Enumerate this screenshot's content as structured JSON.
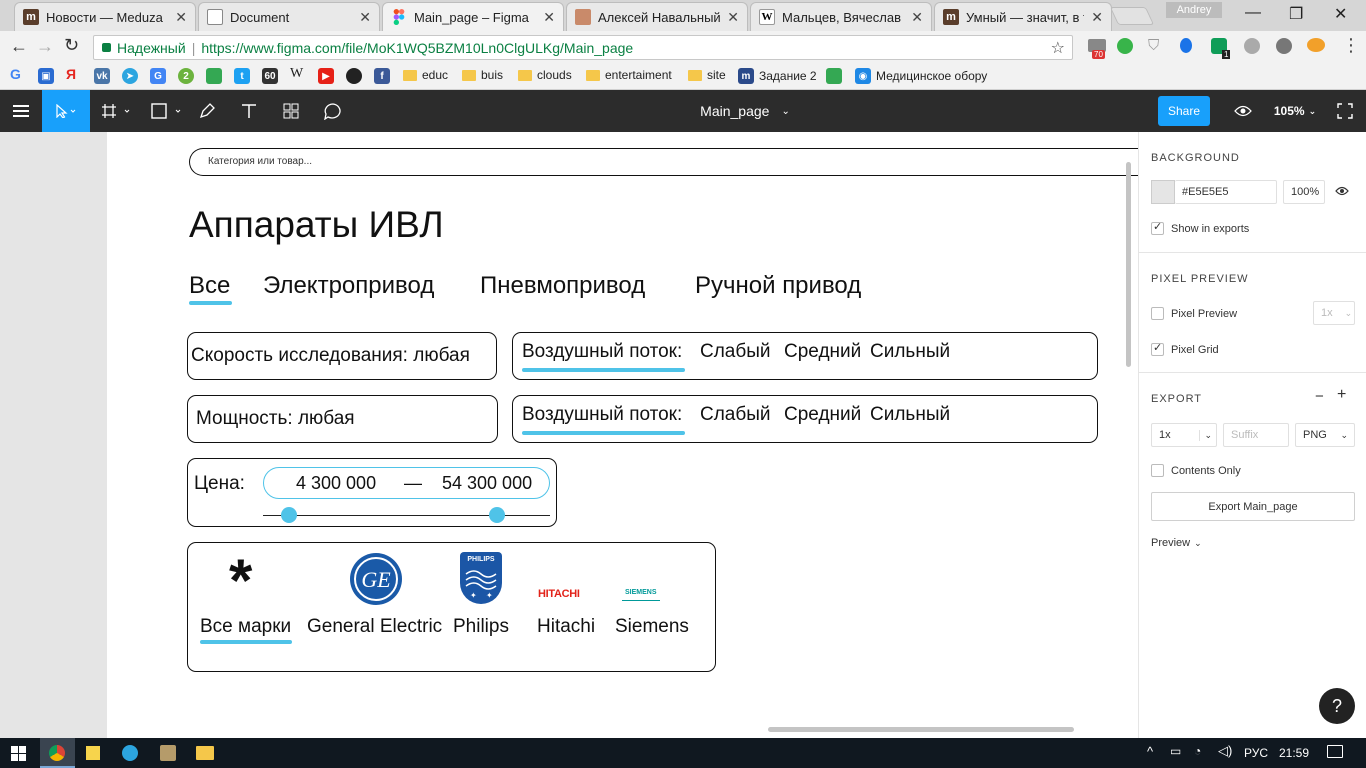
{
  "browser": {
    "tabs": [
      {
        "title": "Новости — Meduza",
        "icon": "meduza-icon"
      },
      {
        "title": "Document",
        "icon": "document-icon"
      },
      {
        "title": "Main_page – Figma",
        "icon": "figma-icon",
        "active": true
      },
      {
        "title": "Алексей Навальный",
        "icon": "avatar-icon"
      },
      {
        "title": "Мальцев, Вячеслав Вя",
        "icon": "wikipedia-icon"
      },
      {
        "title": "Умный — значит, в тк",
        "icon": "meduza-icon"
      }
    ],
    "user_name": "Andrey",
    "secure_label": "Надежный",
    "url": "https://www.figma.com/file/MoK1WQ5BZM10Ln0ClgULKg/Main_page",
    "ext_badges": {
      "mail": "70",
      "green": "1"
    },
    "bookmarks": [
      "educ",
      "buis",
      "clouds",
      "entertaiment",
      "site",
      "Задание 2",
      "Медицинское обору"
    ]
  },
  "figma": {
    "file_name": "Main_page",
    "share_label": "Share",
    "zoom": "105%",
    "panel": {
      "background_title": "BACKGROUND",
      "bg_hex": "#E5E5E5",
      "bg_opacity": "100%",
      "show_in_exports": "Show in exports",
      "pixel_preview_title": "PIXEL PREVIEW",
      "pixel_preview": "Pixel Preview",
      "pixel_preview_scale": "1x",
      "pixel_grid": "Pixel Grid",
      "export_title": "EXPORT",
      "export_scale": "1x",
      "suffix_placeholder": "Suffix",
      "format": "PNG",
      "contents_only": "Contents Only",
      "export_button": "Export Main_page",
      "preview": "Preview"
    }
  },
  "design": {
    "search_placeholder": "Категория или товар...",
    "heading": "Аппараты ИВЛ",
    "tabs": [
      "Все",
      "Электропривод",
      "Пневмопривод",
      "Ручной привод"
    ],
    "speed_filter": "Скорость исследования:  любая",
    "power_filter": "Мощность:  любая",
    "airflow_label": "Воздушный поток:",
    "airflow_options": [
      "Слабый",
      "Средний",
      "Сильный"
    ],
    "price_label": "Цена:",
    "price_min": "4 300 000",
    "price_dash": "—",
    "price_max": "54 300 000",
    "brands": [
      "Все марки",
      "General Electric",
      "Philips",
      "Hitachi",
      "Siemens"
    ],
    "brand_logo_text": {
      "philips": "PHILIPS",
      "hitachi": "HITACHI",
      "siemens": "SIEMENS",
      "all": "*"
    }
  },
  "taskbar": {
    "lang": "РУС",
    "time": "21:59"
  },
  "colors": {
    "accent": "#4FC3E8",
    "figma_dark": "#2C2C2C",
    "share_blue": "#18A0FB",
    "canvas": "#E5E5E5"
  }
}
